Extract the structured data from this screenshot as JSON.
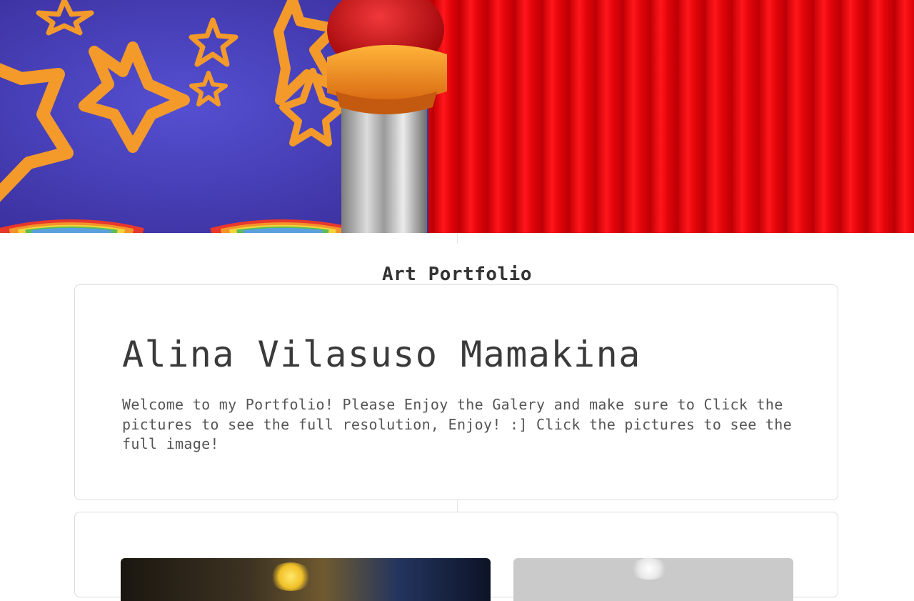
{
  "header": {
    "banner_alt": "Circus banner with stars, rainbows and red curtain"
  },
  "site": {
    "title": "Art Portfolio"
  },
  "intro": {
    "name": "Alina Vilasuso Mamakina",
    "welcome": "Welcome to my Portfolio! Please Enjoy the Galery and make sure to Click the pictures to see the full resolution, Enjoy! :] Click the pictures to see the full image!"
  },
  "gallery": {
    "items": [
      {
        "alt": "Painting with golden flower on dark background"
      },
      {
        "alt": "Grayscale drawing"
      }
    ]
  },
  "colors": {
    "banner_blue": "#4a3fb8",
    "curtain_red": "#e2070d",
    "star_orange": "#f39a2a",
    "text": "#3a3a3a",
    "card_border": "#dcdcdc"
  }
}
